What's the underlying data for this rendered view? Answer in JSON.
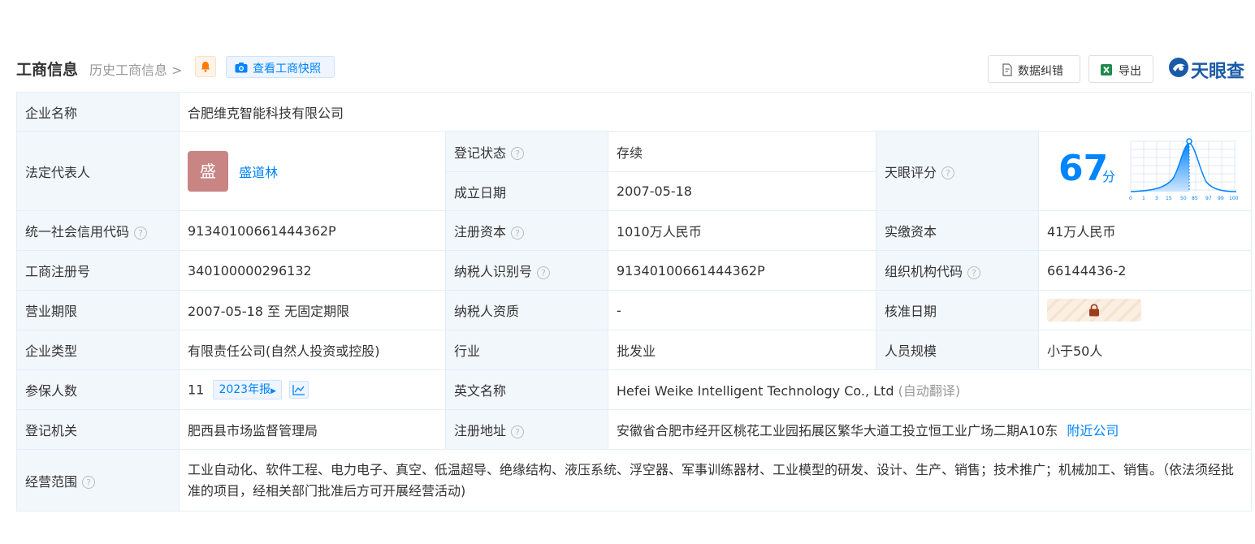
{
  "header": {
    "title": "工商信息",
    "history_link": "历史工商信息",
    "snapshot_button": "查看工商快照",
    "correct_button": "数据纠错",
    "export_button": "导出",
    "logo_text": "天眼查"
  },
  "company": {
    "name_label": "企业名称",
    "name": "合肥维克智能科技有限公司",
    "legal_rep_label": "法定代表人",
    "legal_rep_avatar": "盛",
    "legal_rep": "盛道林",
    "reg_status_label": "登记状态",
    "reg_status": "存续",
    "founded_label": "成立日期",
    "founded": "2007-05-18",
    "score_label": "天眼评分",
    "score": "67",
    "score_unit": "分",
    "score_axis": [
      "0",
      "1",
      "3",
      "15",
      "50",
      "85",
      "97",
      "99",
      "100"
    ],
    "credit_code_label": "统一社会信用代码",
    "credit_code": "91340100661444362P",
    "reg_capital_label": "注册资本",
    "reg_capital": "1010万人民币",
    "paid_capital_label": "实缴资本",
    "paid_capital": "41万人民币",
    "biz_reg_no_label": "工商注册号",
    "biz_reg_no": "340100000296132",
    "taxpayer_id_label": "纳税人识别号",
    "taxpayer_id": "91340100661444362P",
    "org_code_label": "组织机构代码",
    "org_code": "66144436-2",
    "term_label": "营业期限",
    "term": "2007-05-18 至 无固定期限",
    "taxpayer_qual_label": "纳税人资质",
    "taxpayer_qual": "-",
    "approval_date_label": "核准日期",
    "type_label": "企业类型",
    "type": "有限责任公司(自然人投资或控股)",
    "industry_label": "行业",
    "industry": "批发业",
    "staff_size_label": "人员规模",
    "staff_size": "小于50人",
    "insured_label": "参保人数",
    "insured": "11",
    "insured_report_tag": "2023年报",
    "english_name_label": "英文名称",
    "english_name": "Hefei Weike Intelligent Technology Co., Ltd",
    "english_name_note": "(自动翻译)",
    "authority_label": "登记机关",
    "authority": "肥西县市场监督管理局",
    "address_label": "注册地址",
    "address": "安徽省合肥市经开区桃花工业园拓展区繁华大道工投立恒工业广场二期A10东",
    "nearby_link": "附近公司",
    "scope_label": "经营范围",
    "scope": "工业自动化、软件工程、电力电子、真空、低温超导、绝缘结构、液压系统、浮空器、军事训练器材、工业模型的研发、设计、生产、销售；技术推广；机械加工、销售。（依法须经批准的项目，经相关部门批准后方可开展经营活动)"
  },
  "colors": {
    "accent": "#0084ff",
    "status_green": "#1a9e3c",
    "label_bg": "#f2f7fc",
    "border": "#e4eef6"
  }
}
